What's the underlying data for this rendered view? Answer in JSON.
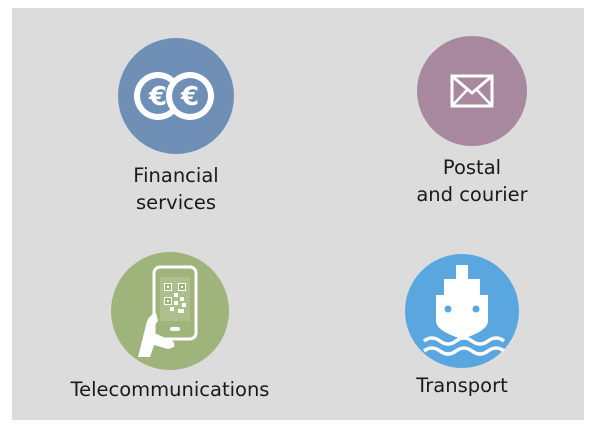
{
  "services": [
    {
      "id": "financial",
      "label": "Financial\nservices",
      "icon": "euro-coins-icon",
      "color": "#6f8fb7"
    },
    {
      "id": "postal",
      "label": "Postal\nand courier",
      "icon": "envelope-icon",
      "color": "#a8889e"
    },
    {
      "id": "telecom",
      "label": "Telecommunications",
      "icon": "hand-phone-qr-icon",
      "color": "#9eb47a"
    },
    {
      "id": "transport",
      "label": "Transport",
      "icon": "ship-icon",
      "color": "#5aa7df"
    }
  ]
}
